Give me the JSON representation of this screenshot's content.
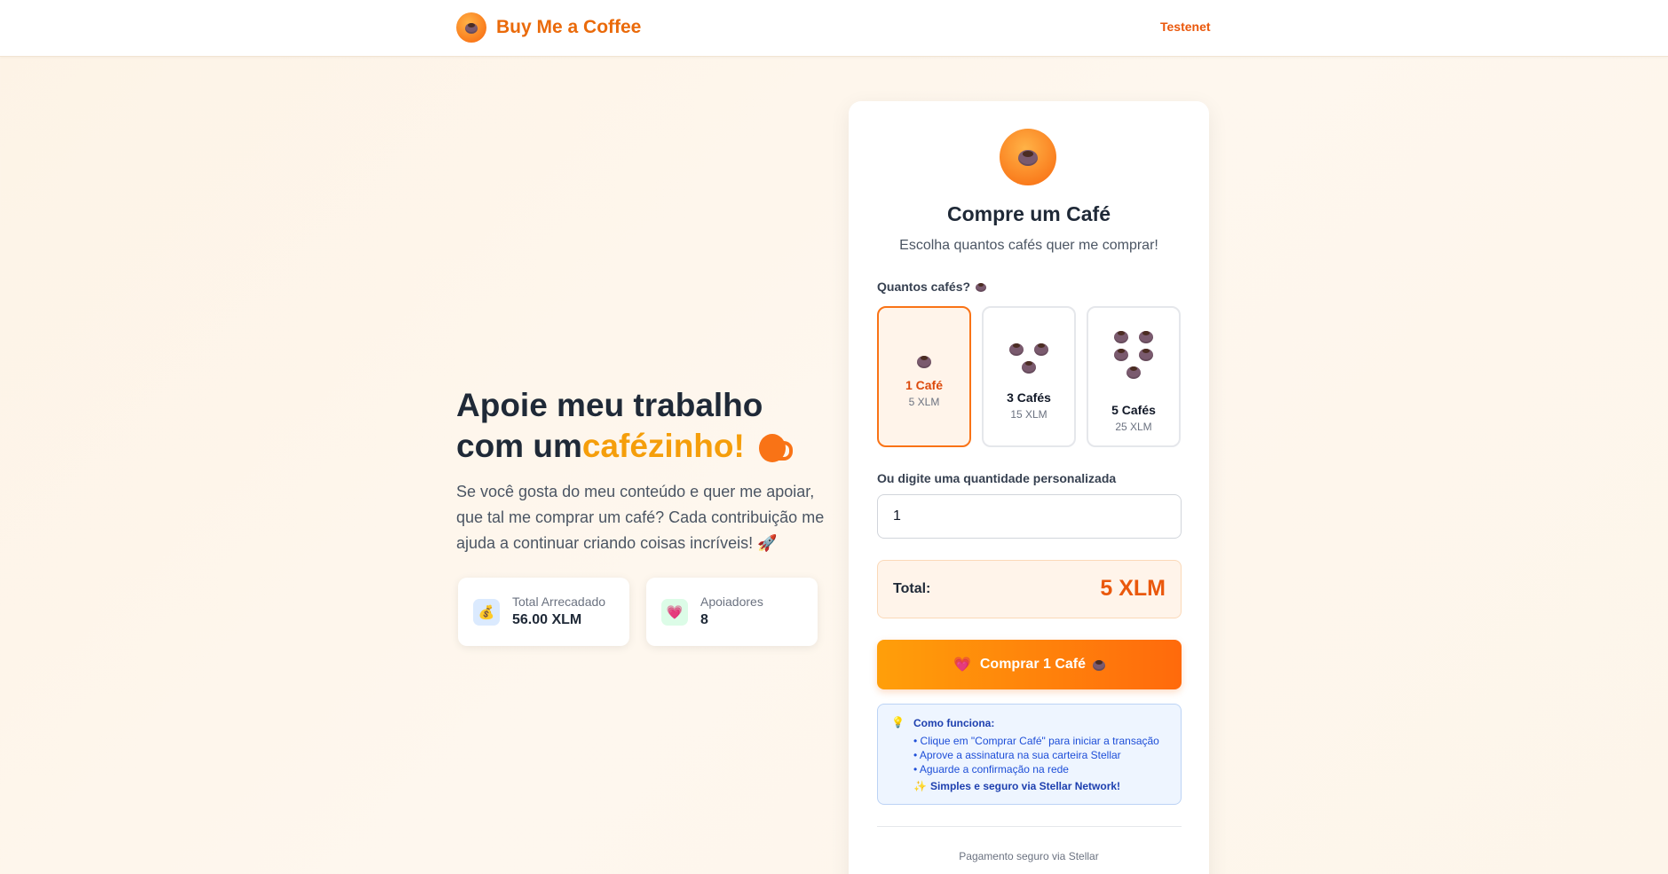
{
  "header": {
    "brand": "Buy Me a Coffee",
    "brand_icon": "coffee-cup-icon",
    "network": "Testenet"
  },
  "hero": {
    "title_line1": "Apoie meu trabalho",
    "title_line2_prefix": "com um",
    "title_line2_accent": "cafézinho!",
    "description": "Se você gosta do meu conteúdo e quer me apoiar, que tal me comprar um café? Cada contribuição me ajuda a continuar criando coisas incríveis! 🚀"
  },
  "stats": [
    {
      "label": "Total Arrecadado",
      "value": "56.00 XLM",
      "icon": "money-bag-icon",
      "icon_bg": "#dbeafe"
    },
    {
      "label": "Apoiadores",
      "value": "8",
      "icon": "heart-icon",
      "icon_bg": "#dcfce7"
    }
  ],
  "card": {
    "title": "Compre um Café",
    "subtitle": "Escolha quantos cafés quer me comprar!",
    "quantity_label": "Quantos cafés?",
    "options": [
      {
        "name": "1 Café",
        "price": "5 XLM",
        "cups": 1,
        "selected": true
      },
      {
        "name": "3 Cafés",
        "price": "15 XLM",
        "cups": 3,
        "selected": false
      },
      {
        "name": "5 Cafés",
        "price": "25 XLM",
        "cups": 5,
        "selected": false
      }
    ],
    "custom_label": "Ou digite uma quantidade personalizada",
    "custom_value": "1",
    "total_label": "Total:",
    "total_value": "5 XLM",
    "buy_button": "Comprar 1 Café",
    "info": {
      "title": "Como funciona:",
      "steps": [
        "• Clique em \"Comprar Café\" para iniciar a transação",
        "• Aprove a assinatura na sua carteira Stellar",
        "• Aguarde a confirmação na rede"
      ],
      "footer": "Simples e seguro via Stellar Network!"
    },
    "footnote": "Pagamento seguro via Stellar"
  },
  "colors": {
    "accent": "#f97316",
    "accent_light": "#f59e0b",
    "info_blue": "#1d4ed8"
  }
}
